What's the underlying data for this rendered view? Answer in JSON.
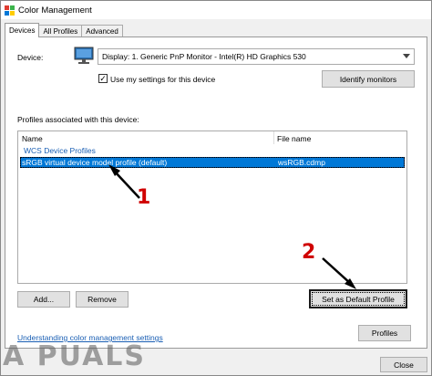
{
  "window": {
    "title": "Color Management"
  },
  "tabs": [
    {
      "label": "Devices",
      "active": true
    },
    {
      "label": "All Profiles",
      "active": false
    },
    {
      "label": "Advanced",
      "active": false
    }
  ],
  "device": {
    "label": "Device:",
    "selected": "Display: 1. Generic PnP Monitor - Intel(R) HD Graphics 530",
    "use_settings_label": "Use my settings for this device",
    "use_settings_checked": true,
    "identify_button": "Identify monitors"
  },
  "profiles": {
    "section_label": "Profiles associated with this device:",
    "columns": [
      "Name",
      "File name"
    ],
    "group": "WCS Device Profiles",
    "rows": [
      {
        "name": "sRGB virtual device model profile (default)",
        "file": "wsRGB.cdmp",
        "selected": true
      }
    ]
  },
  "buttons": {
    "add": "Add...",
    "remove": "Remove",
    "set_default": "Set as Default Profile",
    "profiles": "Profiles",
    "close": "Close"
  },
  "link": "Understanding color management settings",
  "annotations": {
    "step1": "1",
    "step2": "2"
  },
  "watermark": "A PUALS",
  "colors": {
    "accent": "#0078d7",
    "link": "#1a5fb4",
    "annotation": "#d00000"
  }
}
